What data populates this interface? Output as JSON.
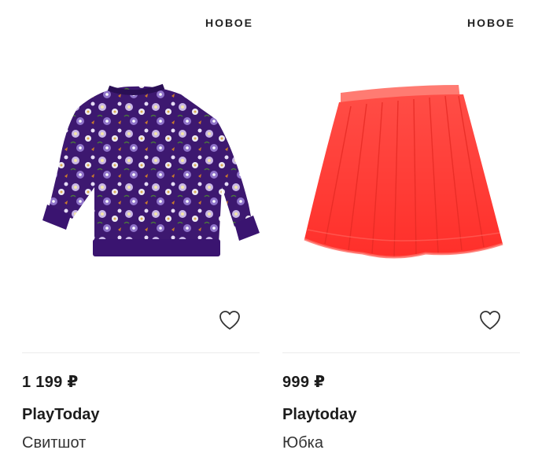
{
  "products": [
    {
      "badge": "НОВОЕ",
      "image": "purple-floral-sweatshirt",
      "favorite_icon": "heart-outline-icon",
      "price": "1 199 ₽",
      "brand": "PlayToday",
      "name": "Свитшот"
    },
    {
      "badge": "НОВОЕ",
      "image": "red-tulle-skirt",
      "favorite_icon": "heart-outline-icon",
      "price": "999 ₽",
      "brand": "Playtoday",
      "name": "Юбка"
    }
  ],
  "colors": {
    "sweatshirt": "#3d1870",
    "skirt": "#ff3b35",
    "text": "#1c1c1c",
    "divider": "#ececec"
  }
}
